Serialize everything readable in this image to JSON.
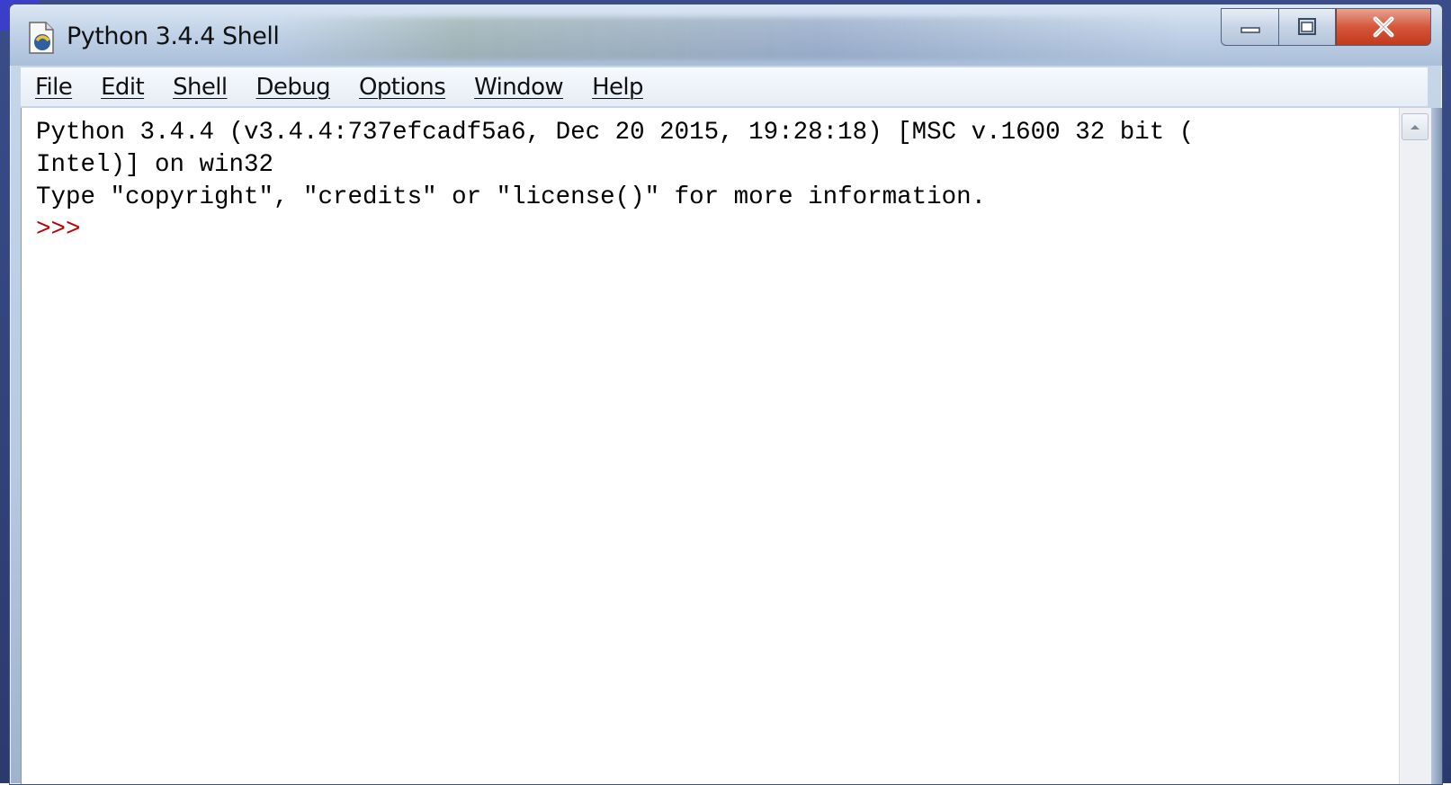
{
  "window": {
    "title": "Python 3.4.4 Shell",
    "icon": "python-idle-icon"
  },
  "window_controls": {
    "minimize_icon": "minimize-icon",
    "maximize_icon": "maximize-icon",
    "close_icon": "close-icon"
  },
  "menu": {
    "items": [
      {
        "label": "File"
      },
      {
        "label": "Edit"
      },
      {
        "label": "Shell"
      },
      {
        "label": "Debug"
      },
      {
        "label": "Options"
      },
      {
        "label": "Window"
      },
      {
        "label": "Help"
      }
    ]
  },
  "shell": {
    "lines": [
      "Python 3.4.4 (v3.4.4:737efcadf5a6, Dec 20 2015, 19:28:18) [MSC v.1600 32 bit (",
      "Intel)] on win32",
      "Type \"copyright\", \"credits\" or \"license()\" for more information."
    ],
    "prompt": ">>>"
  },
  "colors": {
    "prompt": "#c00000",
    "close_button": "#c2391d"
  }
}
